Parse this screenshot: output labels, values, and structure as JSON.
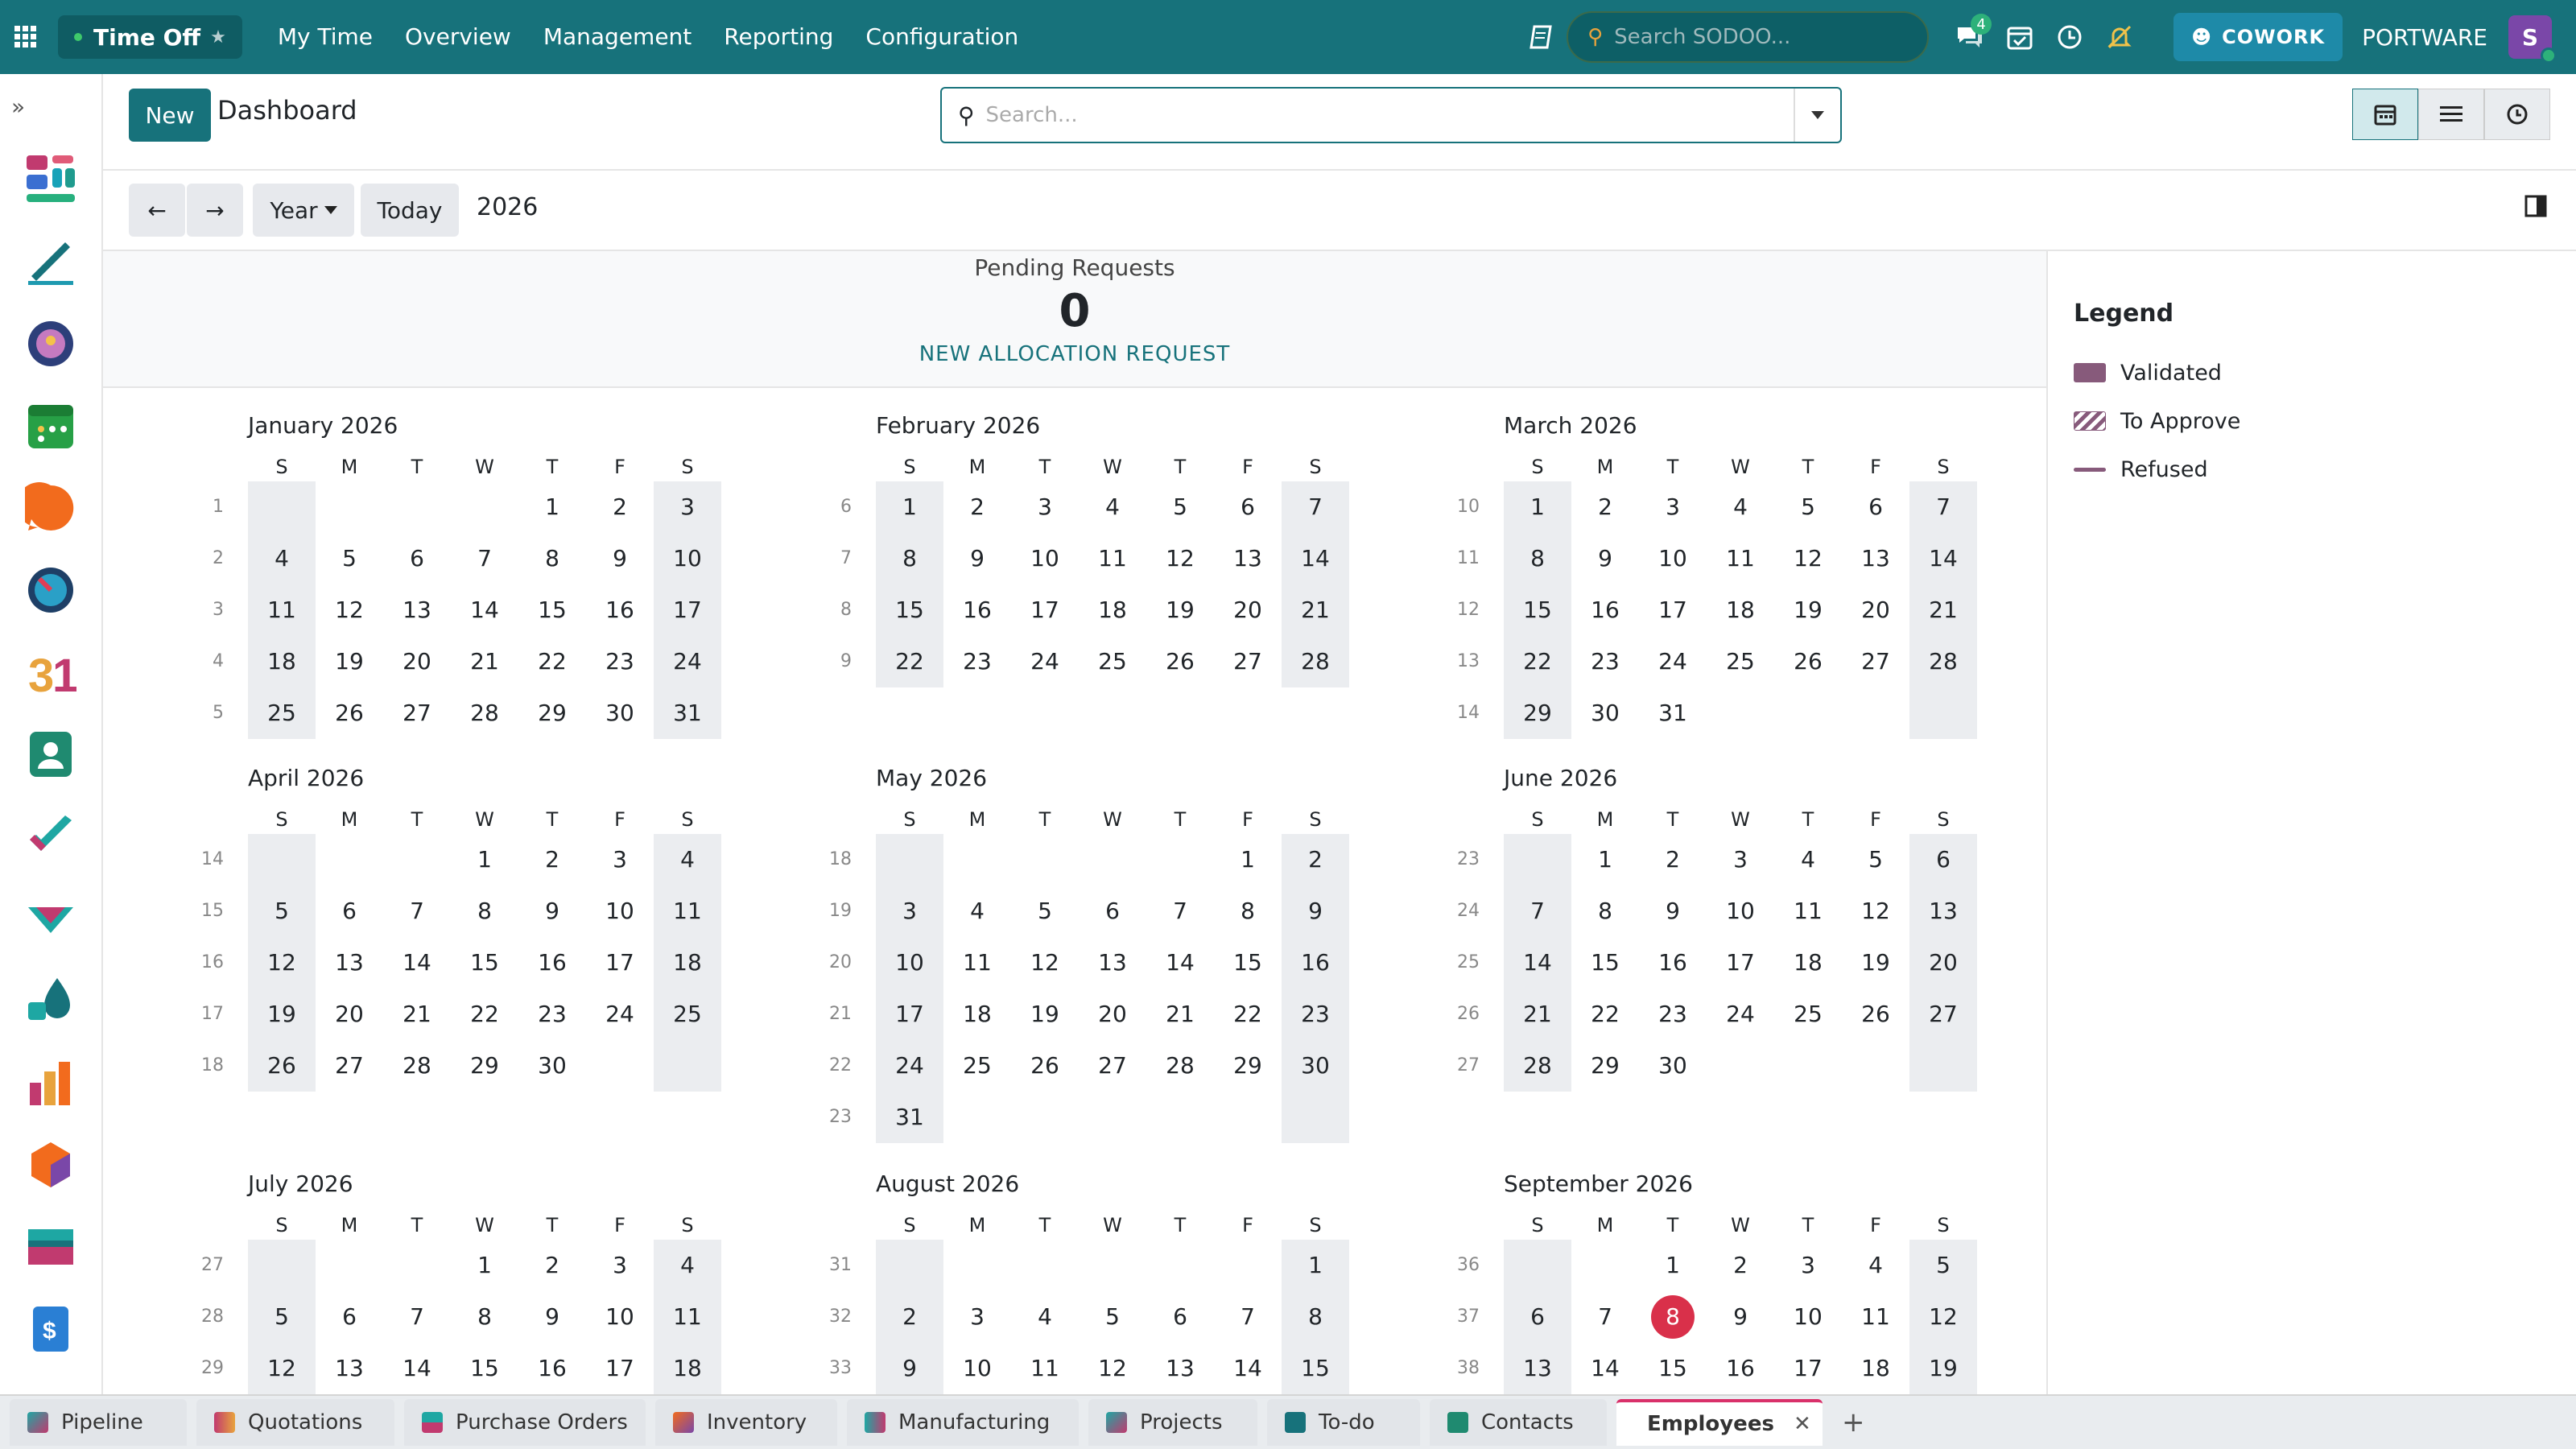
{
  "nav": {
    "app": "Time Off",
    "menu": [
      "My Time",
      "Overview",
      "Management",
      "Reporting",
      "Configuration"
    ],
    "search_placeholder": "Search SODOO...",
    "chat_badge": "4",
    "cowork": "COWORK",
    "company": "PORTWARE",
    "avatar": "S"
  },
  "cp": {
    "new": "New",
    "title": "Dashboard",
    "search_placeholder": "Search..."
  },
  "ctrl": {
    "scale": "Year",
    "today": "Today",
    "year": "2026"
  },
  "pending": {
    "label": "Pending Requests",
    "count": "0",
    "action": "NEW ALLOCATION REQUEST"
  },
  "legend": {
    "title": "Legend",
    "items": [
      "Validated",
      "To Approve",
      "Refused"
    ]
  },
  "days": [
    "S",
    "M",
    "T",
    "W",
    "T",
    "F",
    "S"
  ],
  "months": [
    {
      "name": "January 2026",
      "weeks": [
        [
          1,
          [
            "",
            "",
            "",
            "",
            1,
            2,
            3
          ]
        ],
        [
          2,
          [
            4,
            5,
            6,
            7,
            8,
            9,
            10
          ]
        ],
        [
          3,
          [
            11,
            12,
            13,
            14,
            15,
            16,
            17
          ]
        ],
        [
          4,
          [
            18,
            19,
            20,
            21,
            22,
            23,
            24
          ]
        ],
        [
          5,
          [
            25,
            26,
            27,
            28,
            29,
            30,
            31
          ]
        ]
      ]
    },
    {
      "name": "February 2026",
      "weeks": [
        [
          6,
          [
            1,
            2,
            3,
            4,
            5,
            6,
            7
          ]
        ],
        [
          7,
          [
            8,
            9,
            10,
            11,
            12,
            13,
            14
          ]
        ],
        [
          8,
          [
            15,
            16,
            17,
            18,
            19,
            20,
            21
          ]
        ],
        [
          9,
          [
            22,
            23,
            24,
            25,
            26,
            27,
            28
          ]
        ]
      ]
    },
    {
      "name": "March 2026",
      "weeks": [
        [
          10,
          [
            1,
            2,
            3,
            4,
            5,
            6,
            7
          ]
        ],
        [
          11,
          [
            8,
            9,
            10,
            11,
            12,
            13,
            14
          ]
        ],
        [
          12,
          [
            15,
            16,
            17,
            18,
            19,
            20,
            21
          ]
        ],
        [
          13,
          [
            22,
            23,
            24,
            25,
            26,
            27,
            28
          ]
        ],
        [
          14,
          [
            29,
            30,
            31,
            "",
            "",
            "",
            ""
          ]
        ]
      ]
    },
    {
      "name": "April 2026",
      "weeks": [
        [
          14,
          [
            "",
            "",
            "",
            1,
            2,
            3,
            4
          ]
        ],
        [
          15,
          [
            5,
            6,
            7,
            8,
            9,
            10,
            11
          ]
        ],
        [
          16,
          [
            12,
            13,
            14,
            15,
            16,
            17,
            18
          ]
        ],
        [
          17,
          [
            19,
            20,
            21,
            22,
            23,
            24,
            25
          ]
        ],
        [
          18,
          [
            26,
            27,
            28,
            29,
            30,
            "",
            ""
          ]
        ]
      ]
    },
    {
      "name": "May 2026",
      "weeks": [
        [
          18,
          [
            "",
            "",
            "",
            "",
            "",
            1,
            2
          ]
        ],
        [
          19,
          [
            3,
            4,
            5,
            6,
            7,
            8,
            9
          ]
        ],
        [
          20,
          [
            10,
            11,
            12,
            13,
            14,
            15,
            16
          ]
        ],
        [
          21,
          [
            17,
            18,
            19,
            20,
            21,
            22,
            23
          ]
        ],
        [
          22,
          [
            24,
            25,
            26,
            27,
            28,
            29,
            30
          ]
        ],
        [
          23,
          [
            31,
            "",
            "",
            "",
            "",
            "",
            ""
          ]
        ]
      ]
    },
    {
      "name": "June 2026",
      "weeks": [
        [
          23,
          [
            "",
            1,
            2,
            3,
            4,
            5,
            6
          ]
        ],
        [
          24,
          [
            7,
            8,
            9,
            10,
            11,
            12,
            13
          ]
        ],
        [
          25,
          [
            14,
            15,
            16,
            17,
            18,
            19,
            20
          ]
        ],
        [
          26,
          [
            21,
            22,
            23,
            24,
            25,
            26,
            27
          ]
        ],
        [
          27,
          [
            28,
            29,
            30,
            "",
            "",
            "",
            ""
          ]
        ]
      ]
    },
    {
      "name": "July 2026",
      "weeks": [
        [
          27,
          [
            "",
            "",
            "",
            1,
            2,
            3,
            4
          ]
        ],
        [
          28,
          [
            5,
            6,
            7,
            8,
            9,
            10,
            11
          ]
        ],
        [
          29,
          [
            12,
            13,
            14,
            15,
            16,
            17,
            18
          ]
        ]
      ]
    },
    {
      "name": "August 2026",
      "weeks": [
        [
          31,
          [
            "",
            "",
            "",
            "",
            "",
            "",
            1
          ]
        ],
        [
          32,
          [
            2,
            3,
            4,
            5,
            6,
            7,
            8
          ]
        ],
        [
          33,
          [
            9,
            10,
            11,
            12,
            13,
            14,
            15
          ]
        ]
      ]
    },
    {
      "name": "September 2026",
      "weeks": [
        [
          36,
          [
            "",
            "",
            1,
            2,
            3,
            4,
            5
          ]
        ],
        [
          37,
          [
            6,
            7,
            8,
            9,
            10,
            11,
            12
          ]
        ],
        [
          38,
          [
            13,
            14,
            15,
            16,
            17,
            18,
            19
          ]
        ]
      ]
    }
  ],
  "today": {
    "month": "September 2026",
    "day": 8
  },
  "tabs": [
    "Pipeline",
    "Quotations",
    "Purchase Orders",
    "Inventory",
    "Manufacturing",
    "Projects",
    "To-do",
    "Contacts",
    "Employees"
  ],
  "colors": {
    "brand": "#17727b",
    "validated": "#875a7b",
    "today": "#d9304a"
  }
}
